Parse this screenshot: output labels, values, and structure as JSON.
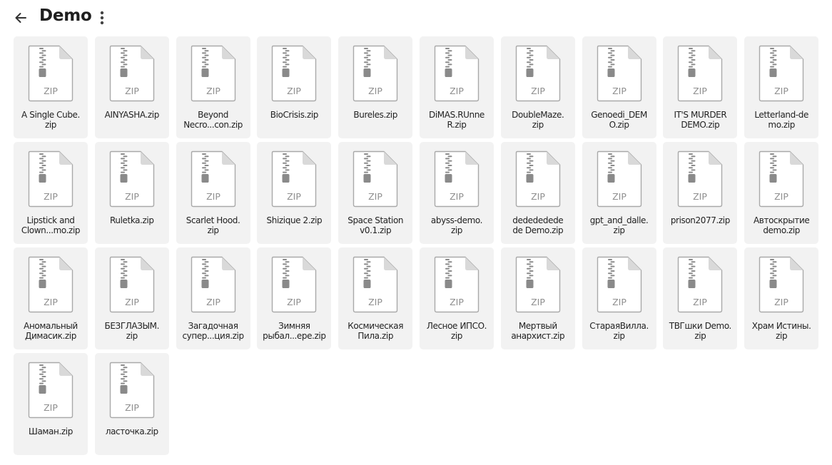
{
  "header": {
    "back_icon": "arrow-left-icon",
    "title": "Demo",
    "more_icon": "vertical-dots-icon"
  },
  "file_icon": {
    "name": "zip-file-icon",
    "label": "ZIP",
    "colors": {
      "page": "#ffffff",
      "outline": "#a9a9a9",
      "fold": "#d9d9d9",
      "zipper": "#8a8a8a",
      "label": "#8f8f8f",
      "tile_bg": "#f2f2f2"
    }
  },
  "files": [
    {
      "name": "A Single Cube.\nzip"
    },
    {
      "name": "AINYASHA.zip"
    },
    {
      "name": "Beyond\nNecro...con.zip"
    },
    {
      "name": "BioCrisis.zip"
    },
    {
      "name": "Bureles.zip"
    },
    {
      "name": "DiMAS.RUnne\nR.zip"
    },
    {
      "name": "DoubleMaze.\nzip"
    },
    {
      "name": "Genoedi_DEM\nO.zip"
    },
    {
      "name": "IT'S MURDER\nDEMO.zip"
    },
    {
      "name": "Letterland-de\nmo.zip"
    },
    {
      "name": "Lipstick and\nClown...mo.zip"
    },
    {
      "name": "Ruletka.zip"
    },
    {
      "name": "Scarlet Hood.\nzip"
    },
    {
      "name": "Shizique 2.zip"
    },
    {
      "name": "Space Station\nv0.1.zip"
    },
    {
      "name": "abyss-demo.\nzip"
    },
    {
      "name": "dedededede\nde Demo.zip"
    },
    {
      "name": "gpt_and_dalle.\nzip"
    },
    {
      "name": "prison2077.zip"
    },
    {
      "name": "Автоскрытие\ndemo.zip"
    },
    {
      "name": "Аномальный\nДимасик.zip"
    },
    {
      "name": "БЕЗГЛАЗЫМ.\nzip"
    },
    {
      "name": "Загадочная\nсупер...ция.zip"
    },
    {
      "name": "Зимняя\nрыбал...ере.zip"
    },
    {
      "name": "Космическая\nПила.zip"
    },
    {
      "name": "Лесное ИПСО.\nzip"
    },
    {
      "name": "Мертвый\nанархист.zip"
    },
    {
      "name": "СтараяВилла.\nzip"
    },
    {
      "name": "ТВГшки Demo.\nzip"
    },
    {
      "name": "Храм Истины.\nzip"
    },
    {
      "name": "Шаман.zip"
    },
    {
      "name": "ласточка.zip"
    }
  ]
}
